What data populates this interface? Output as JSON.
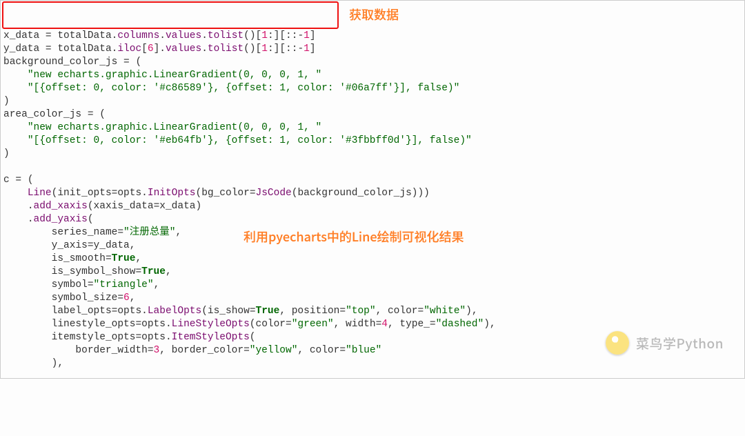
{
  "annotations": {
    "get_data": "获取数据",
    "line_draw": "利用pyecharts中的Line绘制可视化结果"
  },
  "watermark": "菜鸟学Python",
  "code": {
    "lines": [
      {
        "indent": 0,
        "seg": [
          [
            "var",
            "x_data"
          ],
          [
            "op",
            " = "
          ],
          [
            "var",
            "totalData"
          ],
          [
            "op",
            "."
          ],
          [
            "attr",
            "columns"
          ],
          [
            "op",
            "."
          ],
          [
            "attr",
            "values"
          ],
          [
            "op",
            "."
          ],
          [
            "fn",
            "tolist"
          ],
          [
            "paren",
            "()"
          ],
          [
            "op",
            "["
          ],
          [
            "num",
            "1"
          ],
          [
            "op",
            ":]["
          ],
          [
            "op",
            "::"
          ],
          [
            "op",
            "-"
          ],
          [
            "num",
            "1"
          ],
          [
            "op",
            "]"
          ]
        ]
      },
      {
        "indent": 0,
        "seg": [
          [
            "var",
            "y_data"
          ],
          [
            "op",
            " = "
          ],
          [
            "var",
            "totalData"
          ],
          [
            "op",
            "."
          ],
          [
            "fn",
            "iloc"
          ],
          [
            "op",
            "["
          ],
          [
            "num",
            "6"
          ],
          [
            "op",
            "]"
          ],
          [
            "op",
            "."
          ],
          [
            "attr",
            "values"
          ],
          [
            "op",
            "."
          ],
          [
            "fn",
            "tolist"
          ],
          [
            "paren",
            "()"
          ],
          [
            "op",
            "["
          ],
          [
            "num",
            "1"
          ],
          [
            "op",
            ":]["
          ],
          [
            "op",
            "::"
          ],
          [
            "op",
            "-"
          ],
          [
            "num",
            "1"
          ],
          [
            "op",
            "]"
          ]
        ]
      },
      {
        "indent": 0,
        "seg": [
          [
            "var",
            "background_color_js"
          ],
          [
            "op",
            " = "
          ],
          [
            "paren",
            "("
          ]
        ]
      },
      {
        "indent": 1,
        "seg": [
          [
            "str",
            "\"new echarts.graphic.LinearGradient(0, 0, 0, 1, \""
          ]
        ]
      },
      {
        "indent": 1,
        "seg": [
          [
            "str",
            "\"[{offset: 0, color: '#c86589'}, {offset: 1, color: '#06a7ff'}], false)\""
          ]
        ]
      },
      {
        "indent": 0,
        "seg": [
          [
            "paren",
            ")"
          ]
        ]
      },
      {
        "indent": 0,
        "seg": [
          [
            "var",
            "area_color_js"
          ],
          [
            "op",
            " = "
          ],
          [
            "paren",
            "("
          ]
        ]
      },
      {
        "indent": 1,
        "seg": [
          [
            "str",
            "\"new echarts.graphic.LinearGradient(0, 0, 0, 1, \""
          ]
        ]
      },
      {
        "indent": 1,
        "seg": [
          [
            "str",
            "\"[{offset: 0, color: '#eb64fb'}, {offset: 1, color: '#3fbbff0d'}], false)\""
          ]
        ]
      },
      {
        "indent": 0,
        "seg": [
          [
            "paren",
            ")"
          ]
        ]
      },
      {
        "indent": 0,
        "seg": []
      },
      {
        "indent": 0,
        "seg": [
          [
            "var",
            "c"
          ],
          [
            "op",
            " = "
          ],
          [
            "paren",
            "("
          ]
        ]
      },
      {
        "indent": 1,
        "seg": [
          [
            "fn",
            "Line"
          ],
          [
            "paren",
            "("
          ],
          [
            "var",
            "init_opts"
          ],
          [
            "op",
            "="
          ],
          [
            "var",
            "opts"
          ],
          [
            "op",
            "."
          ],
          [
            "fn",
            "InitOpts"
          ],
          [
            "paren",
            "("
          ],
          [
            "var",
            "bg_color"
          ],
          [
            "op",
            "="
          ],
          [
            "fn",
            "JsCode"
          ],
          [
            "paren",
            "("
          ],
          [
            "var",
            "background_color_js"
          ],
          [
            "paren",
            ")))"
          ]
        ]
      },
      {
        "indent": 1,
        "seg": [
          [
            "op",
            "."
          ],
          [
            "fn",
            "add_xaxis"
          ],
          [
            "paren",
            "("
          ],
          [
            "var",
            "xaxis_data"
          ],
          [
            "op",
            "="
          ],
          [
            "var",
            "x_data"
          ],
          [
            "paren",
            ")"
          ]
        ]
      },
      {
        "indent": 1,
        "seg": [
          [
            "op",
            "."
          ],
          [
            "fn",
            "add_yaxis"
          ],
          [
            "paren",
            "("
          ]
        ]
      },
      {
        "indent": 2,
        "seg": [
          [
            "var",
            "series_name"
          ],
          [
            "op",
            "="
          ],
          [
            "str",
            "\"注册总量\""
          ],
          [
            "op",
            ","
          ]
        ]
      },
      {
        "indent": 2,
        "seg": [
          [
            "var",
            "y_axis"
          ],
          [
            "op",
            "="
          ],
          [
            "var",
            "y_data"
          ],
          [
            "op",
            ","
          ]
        ]
      },
      {
        "indent": 2,
        "seg": [
          [
            "var",
            "is_smooth"
          ],
          [
            "op",
            "="
          ],
          [
            "bool",
            "True"
          ],
          [
            "op",
            ","
          ]
        ]
      },
      {
        "indent": 2,
        "seg": [
          [
            "var",
            "is_symbol_show"
          ],
          [
            "op",
            "="
          ],
          [
            "bool",
            "True"
          ],
          [
            "op",
            ","
          ]
        ]
      },
      {
        "indent": 2,
        "seg": [
          [
            "var",
            "symbol"
          ],
          [
            "op",
            "="
          ],
          [
            "str",
            "\"triangle\""
          ],
          [
            "op",
            ","
          ]
        ]
      },
      {
        "indent": 2,
        "seg": [
          [
            "var",
            "symbol_size"
          ],
          [
            "op",
            "="
          ],
          [
            "num",
            "6"
          ],
          [
            "op",
            ","
          ]
        ]
      },
      {
        "indent": 2,
        "seg": [
          [
            "var",
            "label_opts"
          ],
          [
            "op",
            "="
          ],
          [
            "var",
            "opts"
          ],
          [
            "op",
            "."
          ],
          [
            "fn",
            "LabelOpts"
          ],
          [
            "paren",
            "("
          ],
          [
            "var",
            "is_show"
          ],
          [
            "op",
            "="
          ],
          [
            "bool",
            "True"
          ],
          [
            "op",
            ", "
          ],
          [
            "var",
            "position"
          ],
          [
            "op",
            "="
          ],
          [
            "str",
            "\"top\""
          ],
          [
            "op",
            ", "
          ],
          [
            "var",
            "color"
          ],
          [
            "op",
            "="
          ],
          [
            "str",
            "\"white\""
          ],
          [
            "paren",
            ")"
          ],
          [
            "op",
            ","
          ]
        ]
      },
      {
        "indent": 2,
        "seg": [
          [
            "var",
            "linestyle_opts"
          ],
          [
            "op",
            "="
          ],
          [
            "var",
            "opts"
          ],
          [
            "op",
            "."
          ],
          [
            "fn",
            "LineStyleOpts"
          ],
          [
            "paren",
            "("
          ],
          [
            "var",
            "color"
          ],
          [
            "op",
            "="
          ],
          [
            "str",
            "\"green\""
          ],
          [
            "op",
            ", "
          ],
          [
            "var",
            "width"
          ],
          [
            "op",
            "="
          ],
          [
            "num",
            "4"
          ],
          [
            "op",
            ", "
          ],
          [
            "var",
            "type_"
          ],
          [
            "op",
            "="
          ],
          [
            "str",
            "\"dashed\""
          ],
          [
            "paren",
            ")"
          ],
          [
            "op",
            ","
          ]
        ]
      },
      {
        "indent": 2,
        "seg": [
          [
            "var",
            "itemstyle_opts"
          ],
          [
            "op",
            "="
          ],
          [
            "var",
            "opts"
          ],
          [
            "op",
            "."
          ],
          [
            "fn",
            "ItemStyleOpts"
          ],
          [
            "paren",
            "("
          ]
        ]
      },
      {
        "indent": 3,
        "seg": [
          [
            "var",
            "border_width"
          ],
          [
            "op",
            "="
          ],
          [
            "num",
            "3"
          ],
          [
            "op",
            ", "
          ],
          [
            "var",
            "border_color"
          ],
          [
            "op",
            "="
          ],
          [
            "str",
            "\"yellow\""
          ],
          [
            "op",
            ", "
          ],
          [
            "var",
            "color"
          ],
          [
            "op",
            "="
          ],
          [
            "str",
            "\"blue\""
          ]
        ]
      },
      {
        "indent": 2,
        "seg": [
          [
            "paren",
            ")"
          ],
          [
            "op",
            ","
          ]
        ]
      }
    ]
  }
}
